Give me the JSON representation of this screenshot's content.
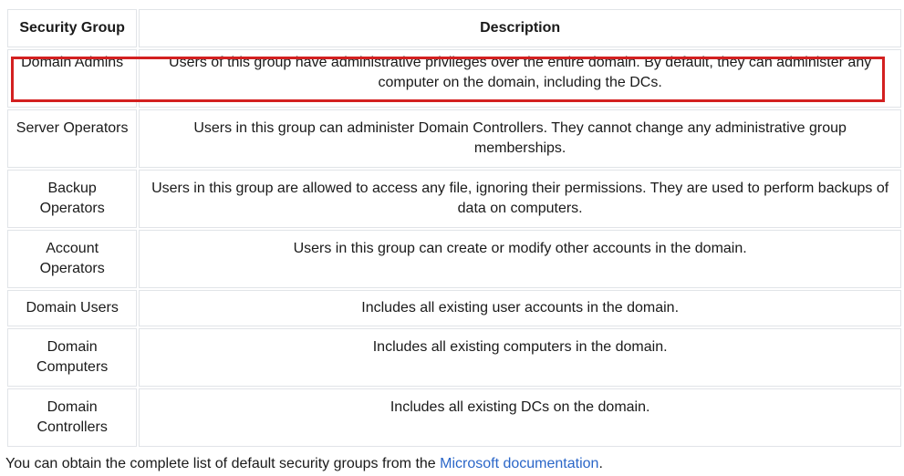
{
  "table": {
    "headers": [
      "Security Group",
      "Description"
    ],
    "rows": [
      {
        "group": "Domain Admins",
        "description": "Users of this group have administrative privileges over the entire domain. By default, they can administer any computer on the domain, including the DCs."
      },
      {
        "group": "Server Operators",
        "description": "Users in this group can administer Domain Controllers. They cannot change any administrative group memberships."
      },
      {
        "group": "Backup Operators",
        "description": "Users in this group are allowed to access any file, ignoring their permissions. They are used to perform backups of data on computers."
      },
      {
        "group": "Account Operators",
        "description": "Users in this group can create or modify other accounts in the domain."
      },
      {
        "group": "Domain Users",
        "description": "Includes all existing user accounts in the domain."
      },
      {
        "group": "Domain Computers",
        "description": "Includes all existing computers in the domain."
      },
      {
        "group": "Domain Controllers",
        "description": "Includes all existing DCs on the domain."
      }
    ]
  },
  "highlight": {
    "color": "#d32020"
  },
  "footer": {
    "text_before": "You can obtain the complete list of default security groups from the ",
    "link_text": "Microsoft documentation",
    "text_after": ".",
    "link_color": "#2a66c8"
  }
}
